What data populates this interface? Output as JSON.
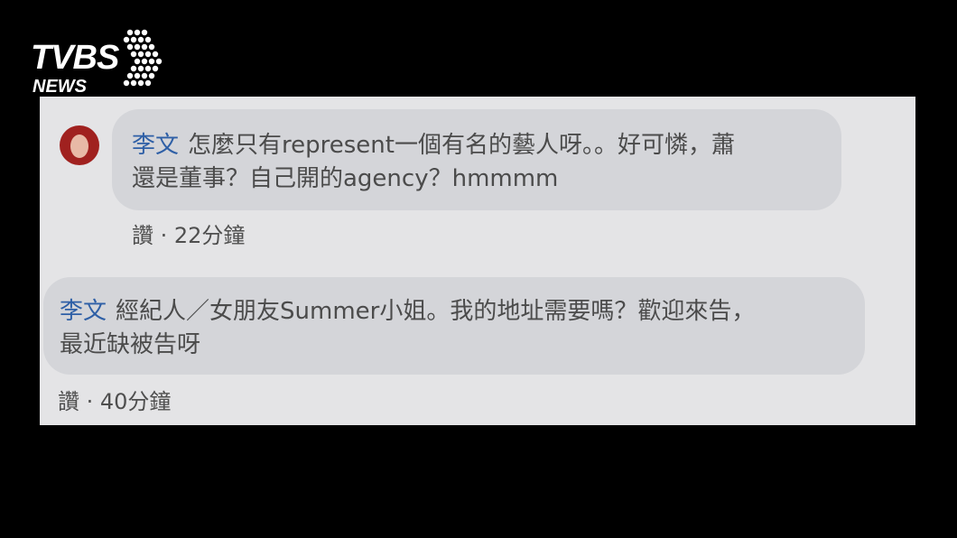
{
  "logo": {
    "main": "TVBS",
    "sub": "NEWS"
  },
  "comments": [
    {
      "author": "李文",
      "line1": "怎麼只有represent一個有名的藝人呀。。好可憐，蕭",
      "line2": "還是董事？自己開的agency？hmmmm",
      "meta": "讚 · 22分鐘"
    },
    {
      "author": "李文",
      "line1": "經紀人／女朋友Summer小姐。我的地址需要嗎？歡迎來告，",
      "line2": "最近缺被告呀",
      "meta": "讚 · 40分鐘"
    }
  ],
  "colors": {
    "name": "#2e5fa6",
    "bubble": "#d4d5d9",
    "panel": "#e4e4e6"
  }
}
